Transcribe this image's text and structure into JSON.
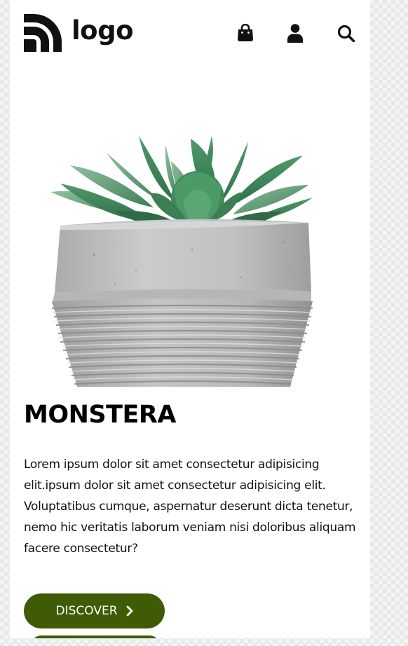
{
  "header": {
    "logo_text": "logo"
  },
  "product": {
    "title": "MONSTERA",
    "description": "Lorem ipsum dolor sit amet consectetur adipisicing elit.ipsum dolor sit amet consectetur adipisicing elit. Voluptatibus cumque, aspernatur deserunt dicta tenetur, nemo hic veritatis laborum veniam nisi doloribus aliquam facere consectetur?",
    "cta_label": "DISCOVER"
  },
  "icons": {
    "cart": "shopping-bag-icon",
    "account": "user-icon",
    "search": "search-icon",
    "cta": "chevron-right-icon"
  },
  "colors": {
    "accent": "#3f5b05",
    "text": "#000000",
    "background": "#ffffff"
  }
}
